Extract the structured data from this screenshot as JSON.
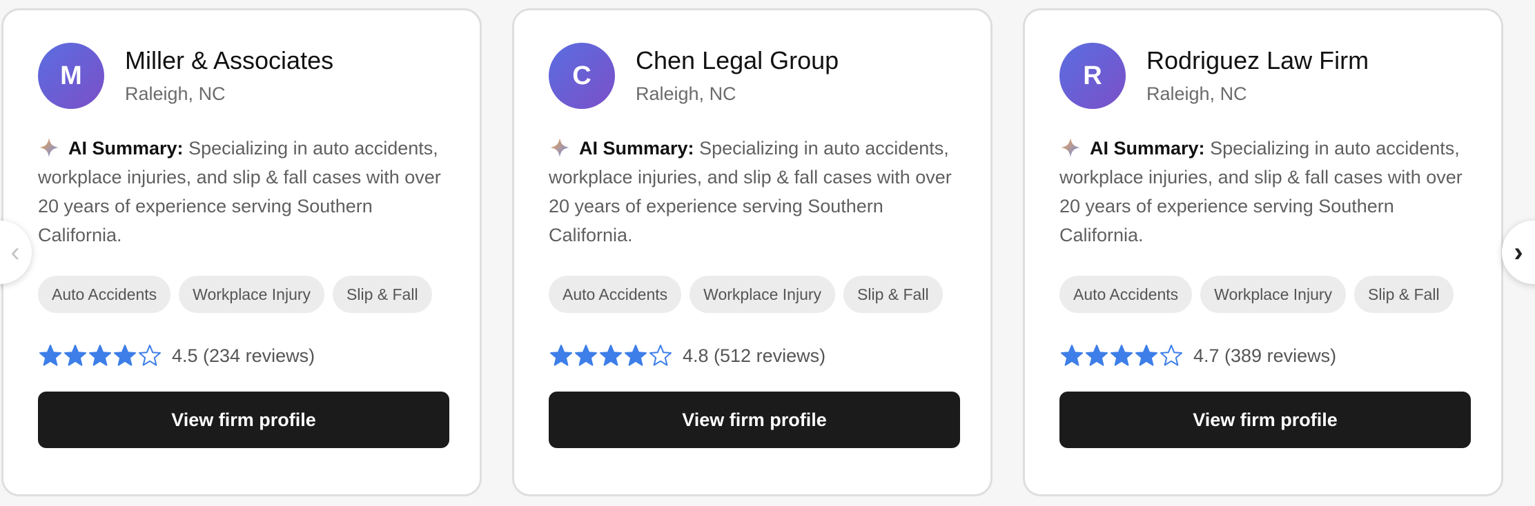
{
  "colors": {
    "star": "#3d7ee8",
    "button_bg": "#1b1b1b",
    "avatar_gradient_start": "#5a6ee0",
    "avatar_gradient_end": "#7b4fc8",
    "tag_bg": "#ececec"
  },
  "carousel": {
    "prev_icon": "chevron-left-icon",
    "prev_glyph": "‹",
    "next_icon": "chevron-right-icon",
    "next_glyph": "›"
  },
  "cards": [
    {
      "initial": "M",
      "name": "Miller & Associates",
      "location": "Raleigh, NC",
      "summary_label": "AI Summary:",
      "summary_text": " Specializing in auto accidents, workplace injuries, and slip & fall cases with over 20 years of experience serving Southern California.",
      "tags": [
        "Auto Accidents",
        "Workplace Injury",
        "Slip & Fall"
      ],
      "rating": 4.5,
      "filled_stars": 4,
      "total_stars": 5,
      "rating_text": "4.5 (234 reviews)",
      "button_label": "View firm profile"
    },
    {
      "initial": "C",
      "name": "Chen Legal Group",
      "location": "Raleigh, NC",
      "summary_label": "AI Summary:",
      "summary_text": " Specializing in auto accidents, workplace injuries, and slip & fall cases with over 20 years of experience serving Southern California.",
      "tags": [
        "Auto Accidents",
        "Workplace Injury",
        "Slip & Fall"
      ],
      "rating": 4.8,
      "filled_stars": 4,
      "total_stars": 5,
      "rating_text": "4.8 (512 reviews)",
      "button_label": "View firm profile"
    },
    {
      "initial": "R",
      "name": "Rodriguez Law Firm",
      "location": "Raleigh, NC",
      "summary_label": "AI Summary:",
      "summary_text": " Specializing in auto accidents, workplace injuries, and slip & fall cases with over 20 years of experience serving Southern California.",
      "tags": [
        "Auto Accidents",
        "Workplace Injury",
        "Slip & Fall"
      ],
      "rating": 4.7,
      "filled_stars": 4,
      "total_stars": 5,
      "rating_text": "4.7 (389 reviews)",
      "button_label": "View firm profile"
    }
  ]
}
